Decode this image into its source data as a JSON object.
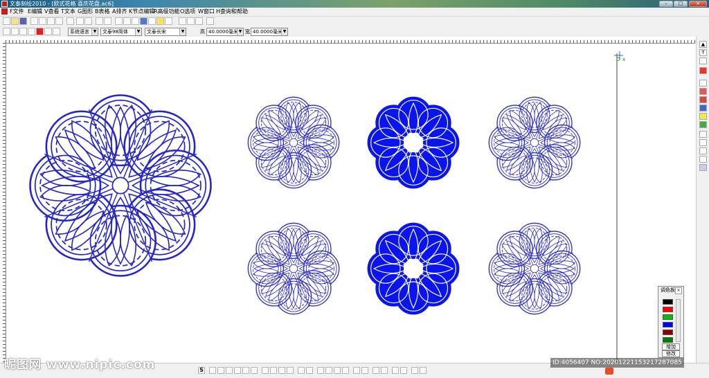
{
  "window": {
    "title": "文泰刻绘2010 - [欧式花格  喜庆花盘.ac6]",
    "min_label": "–",
    "max_label": "□",
    "close_label": "×"
  },
  "menu": [
    {
      "key": "F",
      "label": "文件"
    },
    {
      "key": "E",
      "label": "编辑"
    },
    {
      "key": "V",
      "label": "查看"
    },
    {
      "key": "T",
      "label": "文本"
    },
    {
      "key": "G",
      "label": "图形"
    },
    {
      "key": "B",
      "label": "表格"
    },
    {
      "key": "A",
      "label": "排齐"
    },
    {
      "key": "K",
      "label": "节点编辑"
    },
    {
      "key": "R",
      "label": "高级功能"
    },
    {
      "key": "O",
      "label": "选项"
    },
    {
      "key": "W",
      "label": "窗口"
    },
    {
      "key": "H",
      "label": "查询和帮助"
    }
  ],
  "toolbar2": {
    "language": "系统语言",
    "font_cn": "文泰98简体",
    "font_en": "文泰长宋",
    "height_label": "高",
    "height_value": "40.0000毫米",
    "width_label": "宽",
    "width_value": "40.0000毫米"
  },
  "canvas": {
    "origin_label": "O",
    "origin_x_label": "x",
    "outline_color": "#2222cc",
    "fill_color": "#0a14ef"
  },
  "palette": {
    "title": "调色板",
    "close_label": "×",
    "swatches": [
      "#000000",
      "#ff0000",
      "#00c000",
      "#0000ff",
      "#8b0000",
      "#008000"
    ],
    "add_label": "增加",
    "modify_label": "修改"
  },
  "watermark": "昵图网 www.nipic.com",
  "image_id": "ID:4056407 NO:20201221153217287085"
}
